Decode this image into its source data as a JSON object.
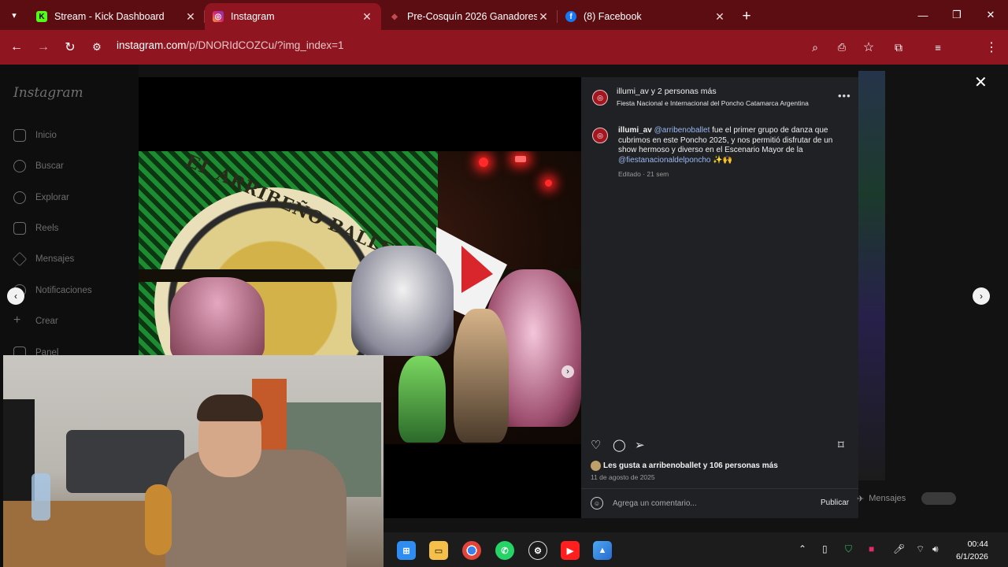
{
  "browser": {
    "tabs": [
      {
        "label": "Stream - Kick Dashboard",
        "favicon": "kick-icon",
        "favicon_glyph": "K",
        "active": false
      },
      {
        "label": "Instagram",
        "favicon": "instagram-icon",
        "favicon_glyph": "◎",
        "active": true
      },
      {
        "label": "Pre-Cosquín 2026 Ganadores d",
        "favicon": "web-icon",
        "favicon_glyph": "◆",
        "active": false
      },
      {
        "label": "(8) Facebook",
        "favicon": "facebook-icon",
        "favicon_glyph": "f",
        "active": false
      }
    ],
    "url_host": "instagram.com",
    "url_path": "/p/DNORIdCOZCu/?img_index=1",
    "accent": "#8f1620"
  },
  "instagram": {
    "logo": "Instagram",
    "nav": [
      "Inicio",
      "Buscar",
      "Explorar",
      "Reels",
      "Mensajes",
      "Notificaciones",
      "Crear",
      "Panel"
    ],
    "messages_label": "Mensajes"
  },
  "post": {
    "header_user": "illumi_av y 2 personas más",
    "header_location": "Fiesta Nacional e Internacional del Poncho Catamarca Argentina",
    "banner_text": "EL ARRIBEÑO BALLET",
    "caption_user": "illumi_av",
    "caption_mention": "@arribenoballet",
    "caption_text": "fue el primer grupo de danza que cubrimos en este Poncho 2025, y nos permitió disfrutar de un show hermoso y diverso en el Escenario Mayor de la",
    "caption_tag": "@fiestanacionaldelponcho",
    "caption_emoji": "✨🙌",
    "edited": "Editado · 21 sem",
    "likes": "Les gusta a arribenoballet y 106 personas más",
    "date": "11 de agosto de 2025",
    "comment_placeholder": "Agrega un comentario...",
    "publish": "Publicar"
  },
  "taskbar": {
    "time": "00:44",
    "date": "6/1/2026"
  }
}
